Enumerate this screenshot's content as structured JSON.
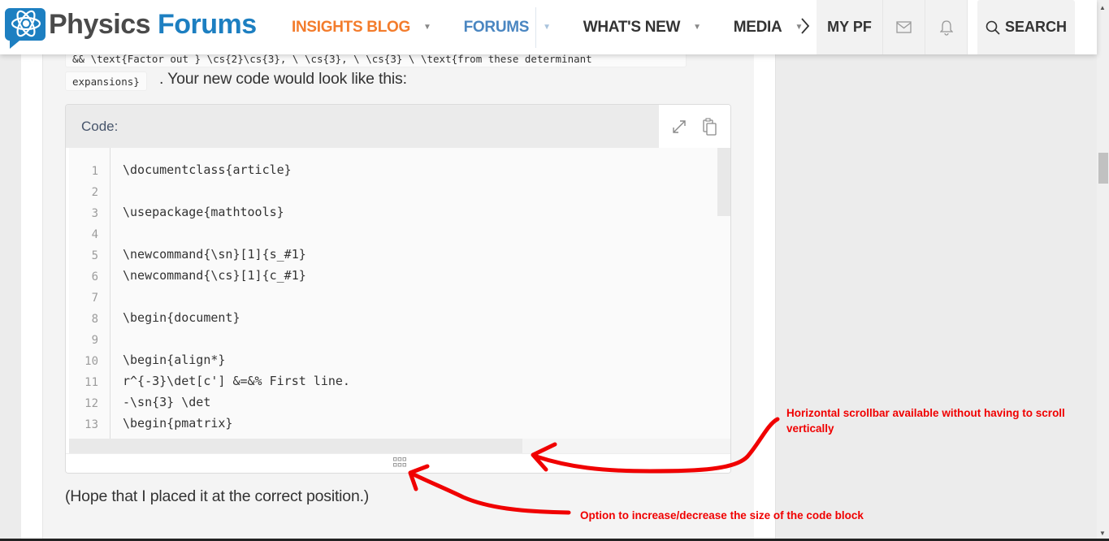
{
  "header": {
    "logo": {
      "word1": "Physics",
      "word2": "Forums",
      "icon": "atom-chat-bubble-icon"
    },
    "nav": [
      {
        "label": "INSIGHTS BLOG",
        "color": "#f37c2c",
        "has_dropdown": true
      },
      {
        "label": "FORUMS",
        "color": "#4a86c1",
        "has_dropdown": true
      },
      {
        "label": "WHAT'S NEW",
        "has_dropdown": true
      },
      {
        "label": "MEDIA",
        "has_dropdown": true
      }
    ],
    "nav_more_icon": "chevron-right-icon",
    "my_pf_label": "MY PF",
    "inbox_icon": "envelope-icon",
    "alerts_icon": "bell-icon",
    "search_label": "SEARCH"
  },
  "post": {
    "inline_code_1": "&& \\text{Factor out } \\cs{2}\\cs{3}, \\ \\cs{3}, \\ \\cs{3} \\ \\text{from these determinant",
    "inline_code_2": "expansions}",
    "para_before": ". Your new code would look like this:",
    "para_after": "(Hope that I placed it at the correct position.)"
  },
  "code_block": {
    "title": "Code:",
    "expand_icon": "expand-arrows-icon",
    "copy_icon": "copy-clipboard-icon",
    "resize_icon": "grid-resize-handle-icon",
    "lines": [
      {
        "n": "1",
        "text": "\\documentclass{article}"
      },
      {
        "n": "2",
        "text": ""
      },
      {
        "n": "3",
        "text": "\\usepackage{mathtools}"
      },
      {
        "n": "4",
        "text": ""
      },
      {
        "n": "5",
        "text": "\\newcommand{\\sn}[1]{s_#1}"
      },
      {
        "n": "6",
        "text": "\\newcommand{\\cs}[1]{c_#1}"
      },
      {
        "n": "7",
        "text": ""
      },
      {
        "n": "8",
        "text": "\\begin{document}"
      },
      {
        "n": "9",
        "text": ""
      },
      {
        "n": "10",
        "text": "\\begin{align*}"
      },
      {
        "n": "11",
        "text": "r^{-3}\\det[c'] &=&% First line."
      },
      {
        "n": "12",
        "text": "-\\sn{3} \\det"
      },
      {
        "n": "13",
        "text": "\\begin{pmatrix}"
      }
    ]
  },
  "annotations": {
    "scrollbar_note": "Horizontal scrollbar available without having to scroll vertically",
    "resize_note": "Option to increase/decrease the size of the code block",
    "color": "#f00000"
  }
}
